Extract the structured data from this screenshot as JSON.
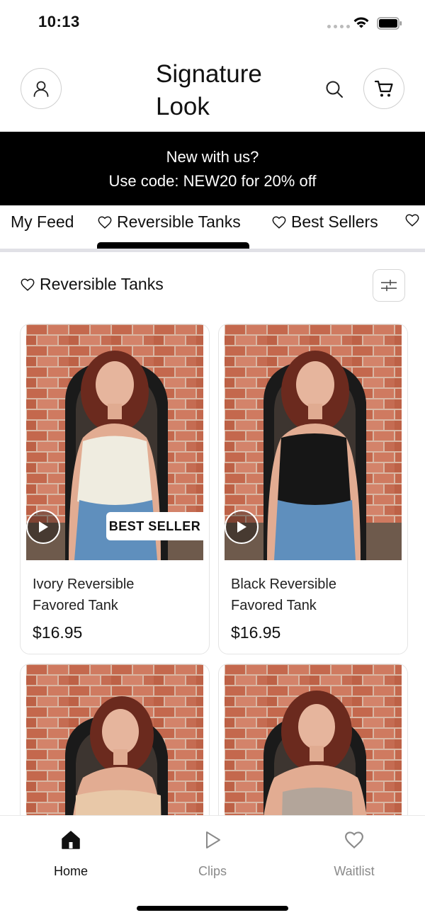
{
  "status_bar": {
    "time": "10:13"
  },
  "header": {
    "brand": "Signature\nLook"
  },
  "promo": {
    "line1": "New with us?",
    "line2": "Use code: NEW20 for 20% off"
  },
  "tabs": [
    {
      "label": "My Feed",
      "heart": false
    },
    {
      "label": "Reversible Tanks",
      "heart": true,
      "active": true
    },
    {
      "label": "Best Sellers",
      "heart": true
    },
    {
      "label": "",
      "heart": true
    }
  ],
  "section": {
    "title": "Reversible Tanks"
  },
  "products": [
    {
      "name": "Ivory Reversible Favored Tank",
      "price": "$16.95",
      "badge": "BEST SELLER",
      "top_color": "#efece0"
    },
    {
      "name": "Black Reversible Favored Tank",
      "price": "$16.95",
      "badge": "",
      "top_color": "#161616"
    },
    {
      "name": "",
      "price": "",
      "badge": "",
      "top_color": "#e8c8a8"
    },
    {
      "name": "",
      "price": "",
      "badge": "",
      "top_color": "#b3a59a"
    }
  ],
  "bottom_nav": [
    {
      "label": "Home",
      "icon": "home-icon",
      "active": true
    },
    {
      "label": "Clips",
      "icon": "play-outline-icon",
      "active": false
    },
    {
      "label": "Waitlist",
      "icon": "heart-outline-icon",
      "active": false
    }
  ],
  "colors": {
    "banner_bg": "#000000",
    "active": "#111111",
    "inactive": "#8a8a8a",
    "brick": "#c4684d"
  }
}
